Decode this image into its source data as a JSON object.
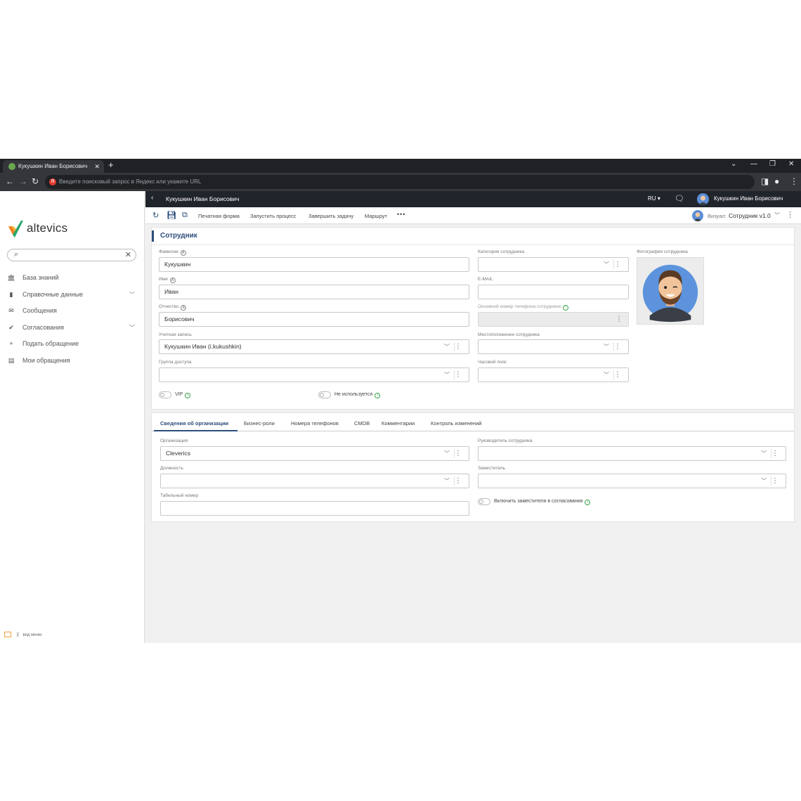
{
  "browser": {
    "tab_title": "Кукушкин Иван Борисович",
    "tab_close": "✕",
    "new_tab": "+",
    "omnibox_placeholder": "Введите поисковый запрос в Яндекс или укажите URL",
    "yandex_badge": "Я",
    "controls": {
      "minimize": "—",
      "restore": "❐",
      "close": "✕",
      "tabs_menu": "⌄"
    }
  },
  "sidebar": {
    "logo_text": "altevics",
    "search_value": "",
    "items": [
      {
        "label": "База знаний",
        "icon": "bank-icon",
        "glyph": "🏛",
        "expandable": false
      },
      {
        "label": "Справочные данные",
        "icon": "book-icon",
        "glyph": "▮",
        "expandable": true
      },
      {
        "label": "Сообщения",
        "icon": "mail-icon",
        "glyph": "✉",
        "expandable": false
      },
      {
        "label": "Согласования",
        "icon": "check-icon",
        "glyph": "✔",
        "expandable": true
      },
      {
        "label": "Подать обращение",
        "icon": "plus-icon",
        "glyph": "+",
        "expandable": false
      },
      {
        "label": "Мои обращения",
        "icon": "list-icon",
        "glyph": "▤",
        "expandable": false
      }
    ],
    "view_menu_label": "вид меню"
  },
  "header": {
    "title": "Кукушкин Иван Борисович",
    "language": "RU ▾",
    "user_name": "Кукушкин Иван Борисович"
  },
  "toolbar": {
    "buttons": [
      "Печатная форма",
      "Запустить процесс",
      "Завершить задачу",
      "Маршрут"
    ],
    "more": "•••",
    "visual_label": "Визуал:",
    "visual_value": "Сотрудник v1.0"
  },
  "employee": {
    "section_title": "Сотрудник",
    "fields": {
      "last_name": {
        "label": "Фамилия",
        "value": "Кукушкин"
      },
      "first_name": {
        "label": "Имя",
        "value": "Иван"
      },
      "patronymic": {
        "label": "Отчество",
        "value": "Борисович"
      },
      "account": {
        "label": "Учетная запись",
        "value": "Кукушкин Иван (i.kukushkin)"
      },
      "access_group": {
        "label": "Группа доступа",
        "value": ""
      },
      "category": {
        "label": "Категория сотрудника",
        "value": ""
      },
      "email": {
        "label": "E-MAIL",
        "value": ""
      },
      "main_phone": {
        "label": "Основной номер телефона сотрудника",
        "value": ""
      },
      "location": {
        "label": "Местоположение сотрудника",
        "value": ""
      },
      "timezone": {
        "label": "Часовой пояс",
        "value": ""
      },
      "photo": {
        "label": "Фотография сотрудника"
      }
    },
    "toggles": {
      "vip": {
        "label": "VIP",
        "on": false
      },
      "not_used": {
        "label": "Не используется",
        "on": false
      }
    }
  },
  "org_tabs": {
    "tabs": [
      "Сведения об организации",
      "Бизнес-роли",
      "Номера телефонов",
      "CMDB",
      "Комментарии",
      "Контроль изменений"
    ],
    "active": 0,
    "fields": {
      "organization": {
        "label": "Организация",
        "value": "Cleverics"
      },
      "position": {
        "label": "Должность",
        "value": ""
      },
      "personnel_number": {
        "label": "Табельный номер",
        "value": ""
      },
      "manager": {
        "label": "Руководитель сотрудника",
        "value": ""
      },
      "deputy": {
        "label": "Заместитель",
        "value": ""
      }
    },
    "deputy_toggle": {
      "label": "Включить заместителя в согласования",
      "on": false
    }
  },
  "colors": {
    "accent": "#2b4d7a",
    "header_bg": "#20242b",
    "ok_green": "#3aa14a"
  }
}
